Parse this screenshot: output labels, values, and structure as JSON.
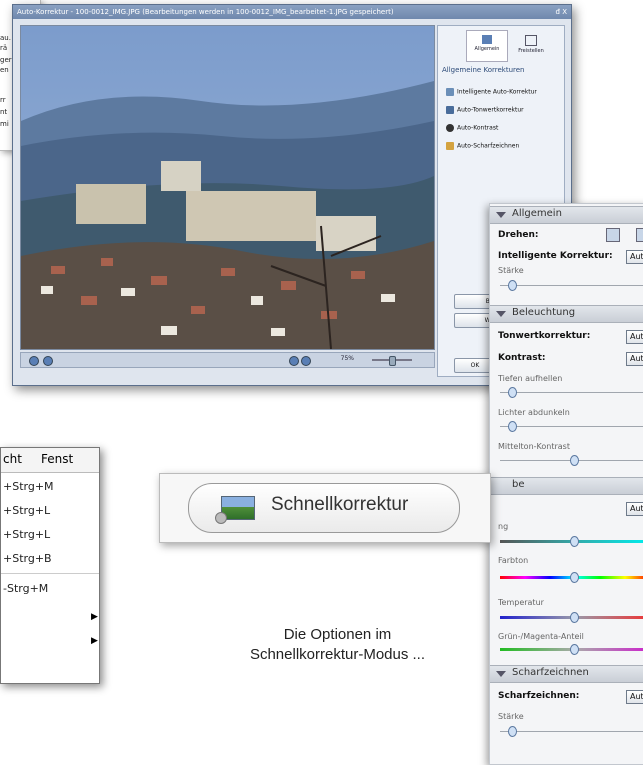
{
  "background_doc": {
    "lines": [
      "au.",
      "rä",
      "ger",
      "en",
      "rr",
      "nt",
      "mi"
    ]
  },
  "dialog": {
    "title": "Auto-Korrektur - 100-0012_IMG.JPG (Bearbeitungen werden in 100-0012_IMG_bearbeitet-1.JPG gespeichert)",
    "window_controls": "đ X",
    "zoom": "75%",
    "tabs": [
      "Allgemein",
      "Freistellen"
    ],
    "section_heading": "Allgemeine Korrekturen",
    "items": [
      "Intelligente Auto-Korrektur",
      "Auto-Tonwertkorrektur",
      "Auto-Kontrast",
      "Auto-Scharfzeichnen"
    ],
    "buttons": [
      "Bild zurü",
      "Weiter be",
      "OK"
    ]
  },
  "panel": {
    "allgemein": "Allgemein",
    "drehen": "Drehen:",
    "intelligente": "Intelligente Korrektur:",
    "auto": "Auto",
    "staerke": "Stärke",
    "beleuchtung": "Beleuchtung",
    "tonwert": "Tonwertkorrektur:",
    "kontrast": "Kontrast:",
    "tiefen": "Tiefen aufhellen",
    "lichter": "Lichter abdunkeln",
    "mittelton": "Mittelton-Kontrast",
    "farbe": "be",
    "saettigung": "ng",
    "farbton": "Farbton",
    "temperatur": "Temperatur",
    "gruen": "Grün-/Magenta-Anteil",
    "scharfzeichnen": "Scharfzeichnen",
    "scharf_label": "Scharfzeichnen:",
    "staerke2": "Stärke"
  },
  "menu": {
    "bar": [
      "cht",
      "Fenst"
    ],
    "items": [
      "+Strg+M",
      "+Strg+L",
      "+Strg+L",
      "+Strg+B",
      "-Strg+M"
    ]
  },
  "quickfix": {
    "label": "Schnellkorrektur"
  },
  "caption": {
    "line1": "Die Optionen im",
    "line2": "Schnellkorrektur-Modus ..."
  },
  "colors": {
    "accent": "#2c4a78",
    "titlebar": "#7a92b6"
  }
}
